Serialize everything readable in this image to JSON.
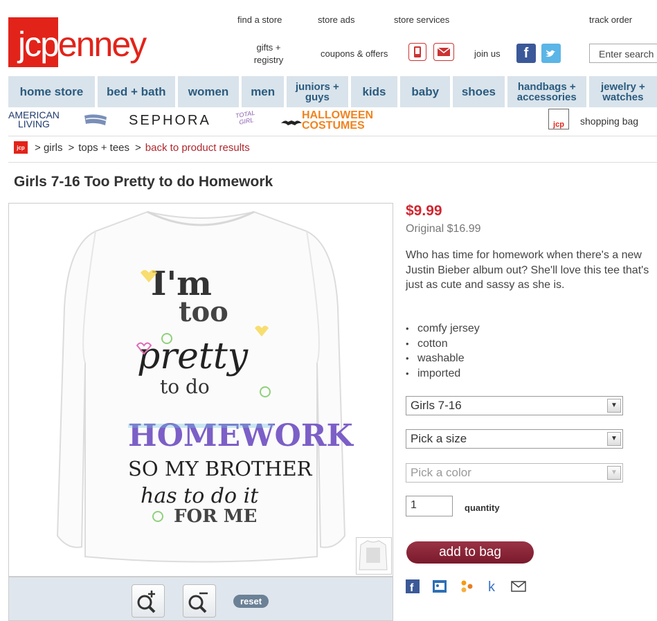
{
  "header": {
    "logo": {
      "box": "jcp",
      "rest": "enney"
    },
    "links": {
      "find_store": "find a store",
      "store_ads": "store ads",
      "store_services": "store services",
      "track_order": "track order",
      "gifts_line1": "gifts +",
      "gifts_line2": "registry",
      "coupons": "coupons & offers",
      "join_us": "join us"
    },
    "search_placeholder": "Enter search"
  },
  "nav": {
    "items": [
      {
        "label": "home store"
      },
      {
        "label": "bed + bath"
      },
      {
        "label": "women"
      },
      {
        "label": "men"
      },
      {
        "label1": "juniors +",
        "label2": "guys"
      },
      {
        "label": "kids"
      },
      {
        "label": "baby"
      },
      {
        "label": "shoes"
      },
      {
        "label1": "handbags +",
        "label2": "accessories"
      },
      {
        "label1": "jewelry +",
        "label2": "watches"
      }
    ]
  },
  "brands": {
    "american_line1": "AMERICAN",
    "american_line2": "LIVING",
    "sephora": "SEPHORA",
    "total_girl": "TOTAL GIRL",
    "halloween_line1": "HALLOWEEN",
    "halloween_line2": "COSTUMES",
    "shopping_bag": "shopping bag",
    "bag_icon_text": "jcp"
  },
  "breadcrumb": {
    "icon_text": "jcp",
    "girls": "girls",
    "tops": "tops + tees",
    "back": "back to product results",
    "sep": ">"
  },
  "product": {
    "title": "Girls 7-16 Too Pretty to do Homework",
    "price": "$9.99",
    "original": "Original $16.99",
    "description": "Who has time for homework when there's a new Justin Bieber album out? She'll love this tee that's just as cute and sassy as she is.",
    "features": [
      "comfy jersey",
      "cotton",
      "washable",
      "imported"
    ],
    "selects": {
      "range": "Girls 7-16",
      "size": "Pick a size",
      "color": "Pick a color"
    },
    "quantity_value": "1",
    "quantity_label": "quantity",
    "add_to_bag": "add to bag",
    "shirt_text": {
      "l1": "I'm",
      "l2": "too",
      "l3": "pretty",
      "l4": "to do",
      "l5": "HOMEWORK",
      "l6": "SO MY BROTHER",
      "l7": "has to do it",
      "l8": "FOR ME"
    }
  },
  "zoom": {
    "reset": "reset"
  },
  "colors": {
    "brand_red": "#e2231a",
    "nav_bg": "#d9e3eb",
    "nav_text": "#2a5b7f",
    "price": "#d22630",
    "add_bag": "#7a1a2c"
  }
}
